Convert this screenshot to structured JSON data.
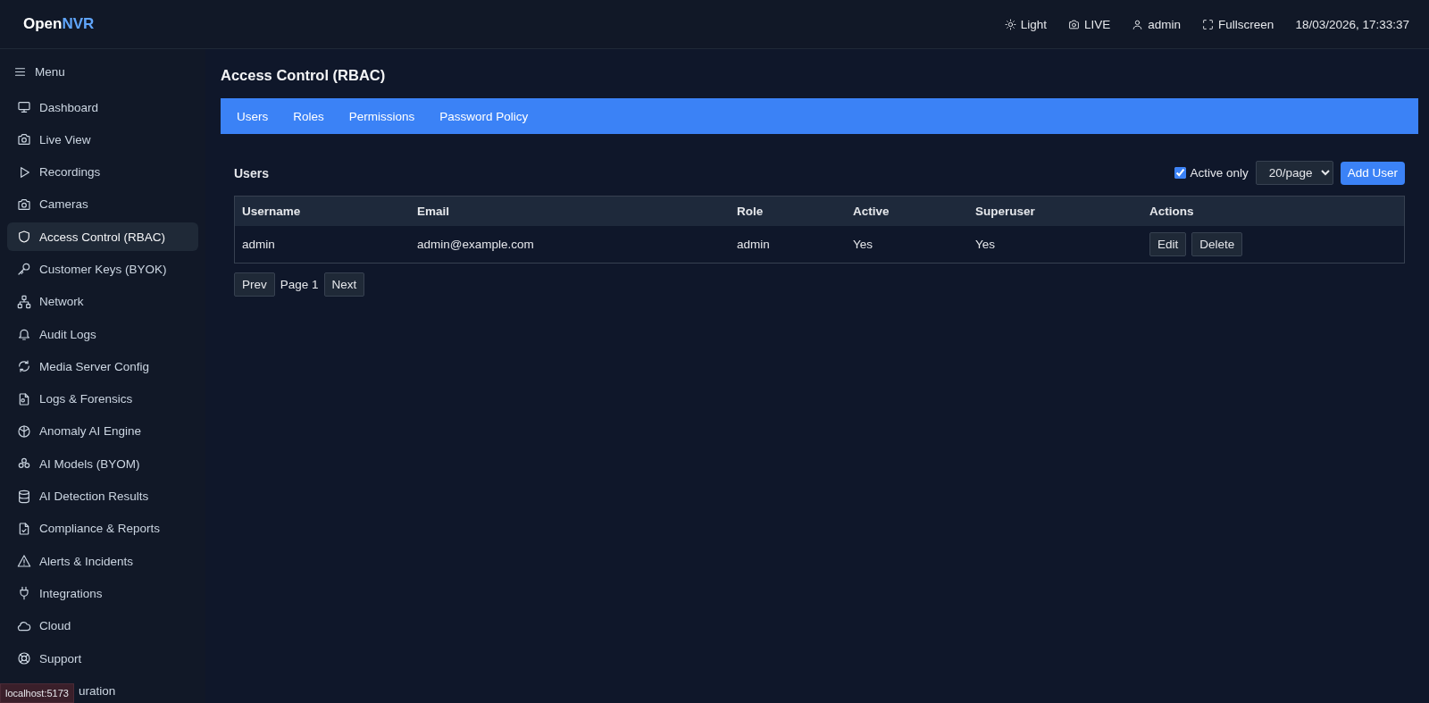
{
  "app": {
    "logo_part_1": "Open",
    "logo_part_2": "NVR"
  },
  "header_actions": [
    {
      "label": "Light"
    },
    {
      "label": "LIVE"
    },
    {
      "label": "admin"
    },
    {
      "label": "Fullscreen"
    }
  ],
  "datetime": "18/03/2026, 17:33:37",
  "sidebar": {
    "menu_label": "Menu",
    "items": [
      {
        "label": "Dashboard",
        "selected": false
      },
      {
        "label": "Live View",
        "selected": false
      },
      {
        "label": "Recordings",
        "selected": false
      },
      {
        "label": "Cameras",
        "selected": false
      },
      {
        "label": "Access Control (RBAC)",
        "selected": true
      },
      {
        "label": "Customer Keys (BYOK)",
        "selected": false
      },
      {
        "label": "Network",
        "selected": false
      },
      {
        "label": "Audit Logs",
        "selected": false
      },
      {
        "label": "Media Server Config",
        "selected": false
      },
      {
        "label": "Logs & Forensics",
        "selected": false
      },
      {
        "label": "Anomaly AI Engine",
        "selected": false
      },
      {
        "label": "AI Models (BYOM)",
        "selected": false
      },
      {
        "label": "AI Detection Results",
        "selected": false
      },
      {
        "label": "Compliance & Reports",
        "selected": false
      },
      {
        "label": "Alerts & Incidents",
        "selected": false
      },
      {
        "label": "Integrations",
        "selected": false
      },
      {
        "label": "Cloud",
        "selected": false
      },
      {
        "label": "Support",
        "selected": false
      },
      {
        "label": "uration",
        "selected": false
      }
    ]
  },
  "page_title": "Access Control (RBAC)",
  "tabs": [
    {
      "label": "Users"
    },
    {
      "label": "Roles"
    },
    {
      "label": "Permissions"
    },
    {
      "label": "Password Policy"
    }
  ],
  "users_panel": {
    "title": "Users",
    "active_only": {
      "label": "Active only",
      "checked": true
    },
    "page_size": "20/page",
    "add_button": "Add User"
  },
  "table": {
    "columns": [
      "Username",
      "Email",
      "Role",
      "Active",
      "Superuser",
      "Actions"
    ],
    "rows": [
      {
        "cells": [
          "admin",
          "admin@example.com",
          "admin",
          "Yes",
          "Yes"
        ],
        "actions": [
          "Edit",
          "Delete"
        ]
      }
    ]
  },
  "pagination": {
    "prev": "Prev",
    "page": "Page 1",
    "next": "Next"
  },
  "status_bubble": "localhost:5173"
}
